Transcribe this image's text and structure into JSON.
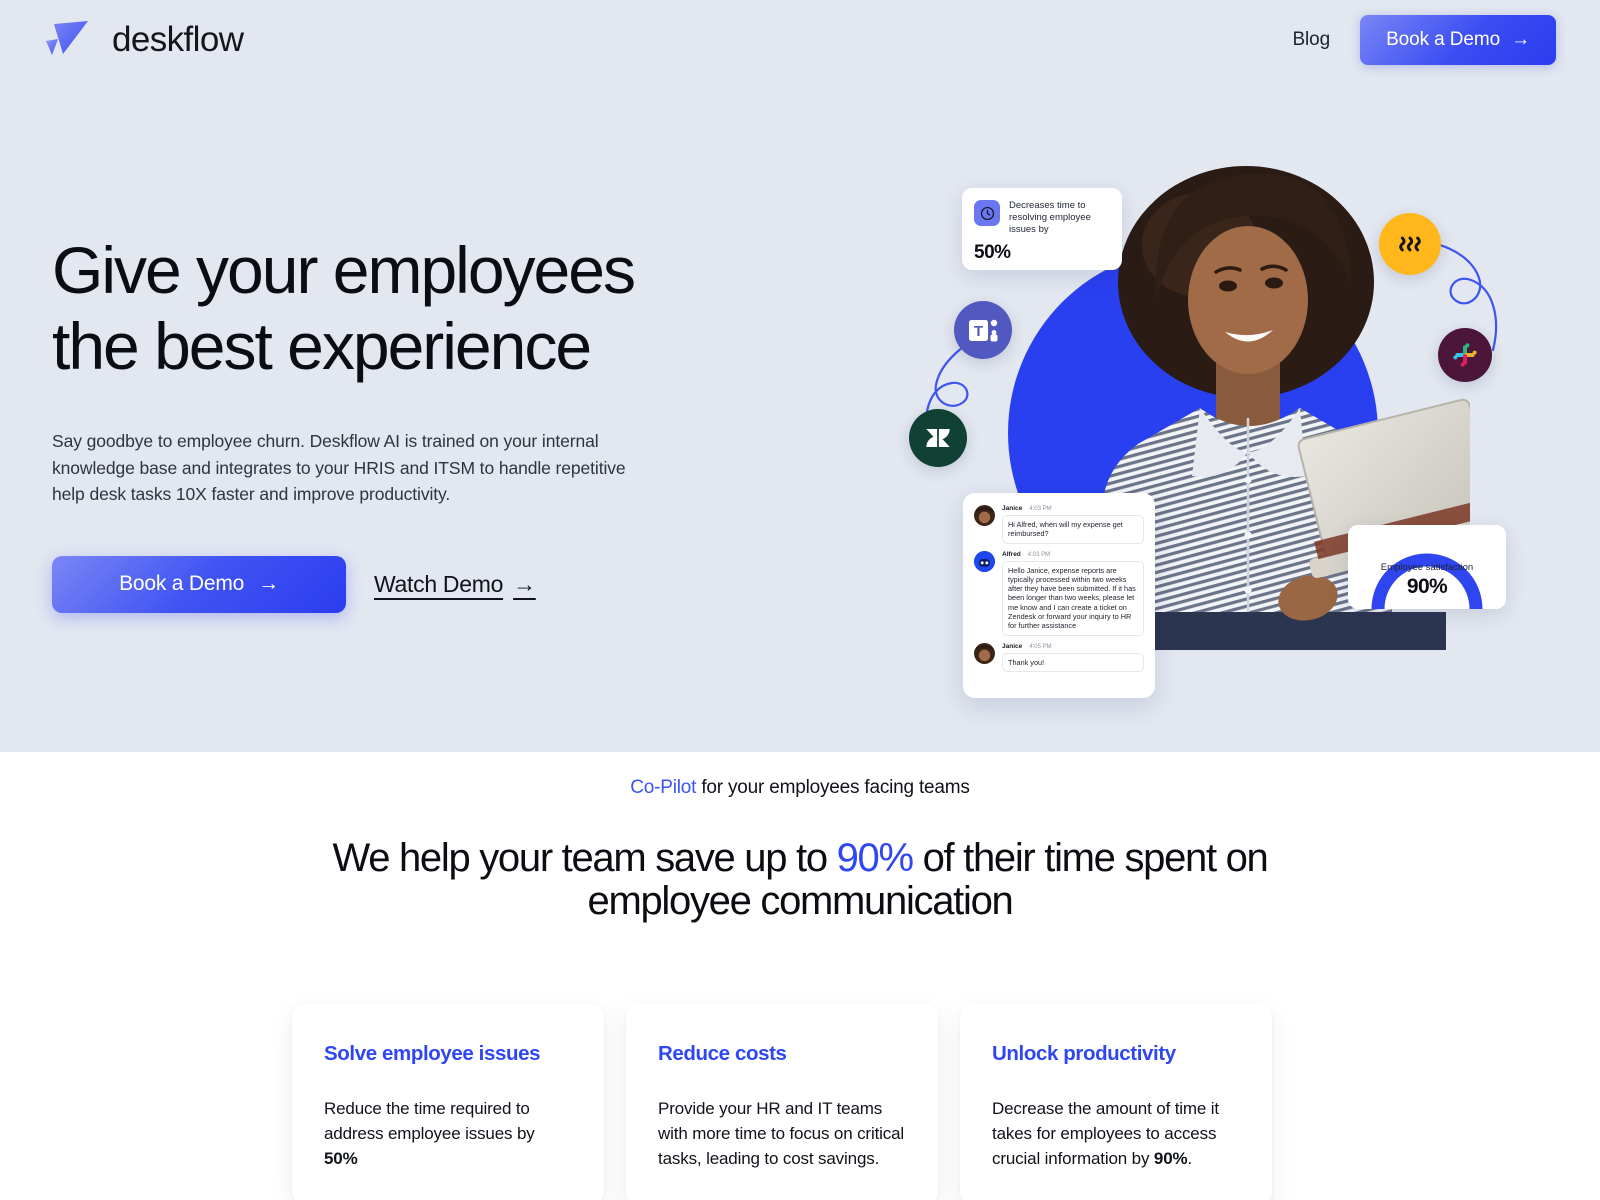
{
  "header": {
    "brand_name": "deskflow",
    "brand_logo_icon": "deskflow-paper-plane-logo",
    "nav_link": "Blog",
    "cta_label": "Book a Demo",
    "cta_arrow": "→"
  },
  "hero": {
    "title_line1": "Give your employees",
    "title_line2": "the best experience",
    "subtitle": "Say goodbye to employee churn. Deskflow AI is trained on your internal knowledge base and integrates to your HRIS and ITSM to handle repetitive help desk tasks 10X faster and improve productivity.",
    "primary_cta": "Book a Demo",
    "primary_cta_arrow": "→",
    "secondary_cta": "Watch Demo",
    "secondary_cta_arrow": "→",
    "background_color": "#e2e7f0"
  },
  "hero_art": {
    "blob_color": "#2940f0",
    "clock_card": {
      "icon": "clock-icon",
      "text": "Decreases time to resolving employee issues by",
      "value": "50%"
    },
    "gauge_card": {
      "label": "Employee satisfaction",
      "value": "90%",
      "arc_color": "#2f45f0",
      "arc_percent": 90
    },
    "app_icons": [
      {
        "name": "microsoft-teams-icon",
        "color": "#5159c0"
      },
      {
        "name": "zendesk-icon",
        "color": "#114034"
      },
      {
        "name": "rippling-icon",
        "color": "#ffb71c"
      },
      {
        "name": "slack-icon",
        "color": "#4b1639"
      }
    ],
    "chat": {
      "messages": [
        {
          "author": "Janice",
          "time": "4:03 PM",
          "text": "Hi Alfred, when will my expense get reimbursed?",
          "avatar": "user-avatar"
        },
        {
          "author": "Alfred",
          "time": "4:03 PM",
          "text": "Hello Janice, expense reports are typically processed within two weeks after they have been submitted. If it has been longer than two weeks, please let me know and I can create a ticket on Zendesk or forward your inquiry to HR for further assistance",
          "avatar": "bot-avatar"
        },
        {
          "author": "Janice",
          "time": "4:05 PM",
          "text": "Thank you!",
          "avatar": "user-avatar"
        }
      ]
    }
  },
  "content": {
    "eyebrow_accent": "Co-Pilot",
    "eyebrow_rest": " for your employees facing teams",
    "heading_part1": "We help your team save up to ",
    "heading_accent": "90%",
    "heading_part2": " of their time spent on employee communication",
    "accent_color": "#2f47f2",
    "cards": [
      {
        "title": "Solve employee issues",
        "text_before": "Reduce the time required to address employee issues by ",
        "text_bold": "50%",
        "text_after": ""
      },
      {
        "title": "Reduce costs",
        "text_before": "Provide your HR and IT teams with more time to focus on critical tasks, leading to cost savings.",
        "text_bold": "",
        "text_after": ""
      },
      {
        "title": "Unlock productivity",
        "text_before": "Decrease the amount of time it takes for employees to access crucial information by ",
        "text_bold": "90%",
        "text_after": "."
      }
    ]
  }
}
